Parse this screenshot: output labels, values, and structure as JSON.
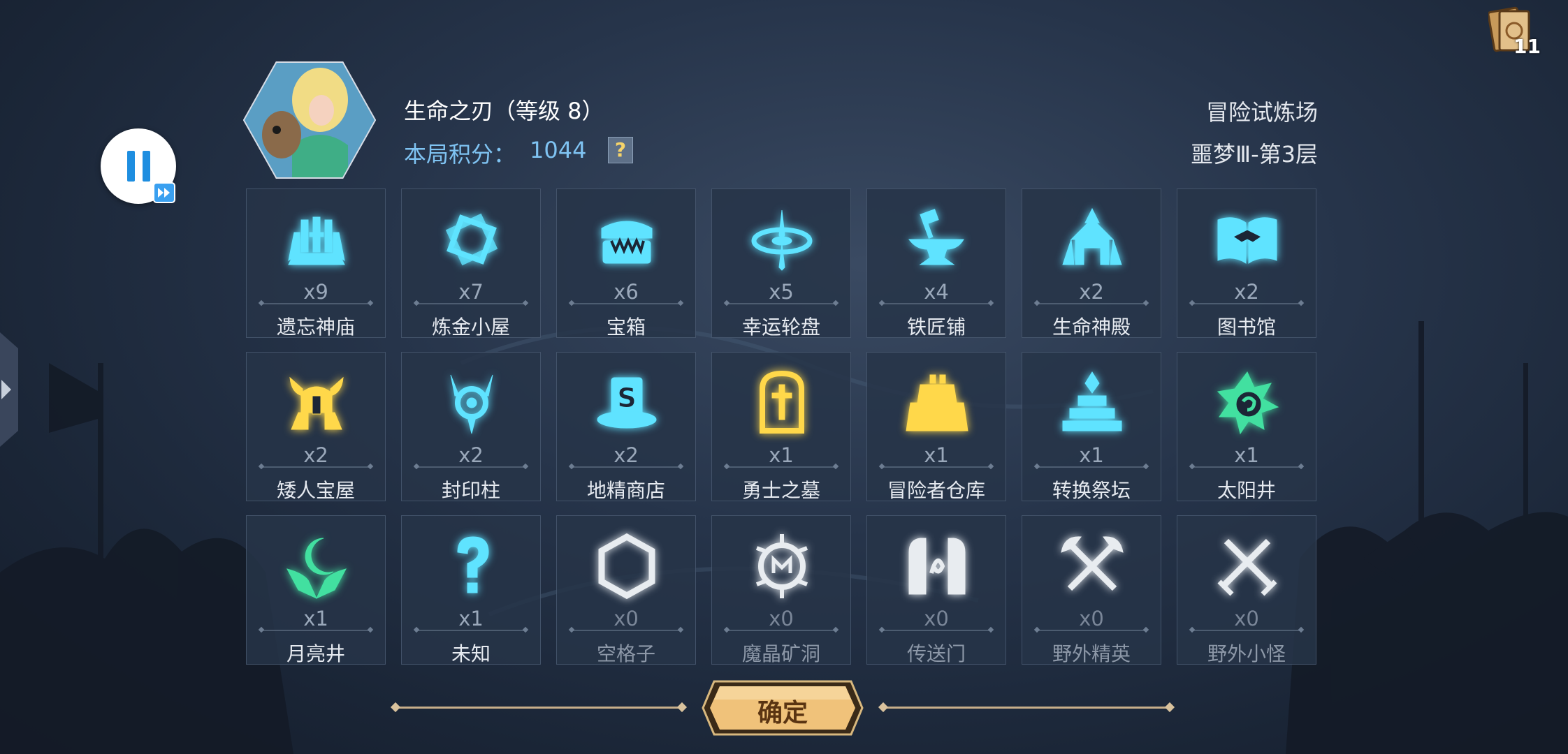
{
  "header": {
    "hero_name": "生命之刃（等级 8）",
    "score_label": "本局积分：",
    "score_value": "1044",
    "help_label": "?",
    "mode_name": "冒险试炼场",
    "floor_name": "噩梦Ⅲ-第3层"
  },
  "top_right": {
    "card_count": "11"
  },
  "tiles": [
    {
      "label": "遗忘神庙",
      "count": "x9",
      "icon": "temple-icon",
      "color": "#5fe3ff"
    },
    {
      "label": "炼金小屋",
      "count": "x7",
      "icon": "alchemy-icon",
      "color": "#5fe3ff"
    },
    {
      "label": "宝箱",
      "count": "x6",
      "icon": "chest-icon",
      "color": "#5fe3ff"
    },
    {
      "label": "幸运轮盘",
      "count": "x5",
      "icon": "wheel-icon",
      "color": "#5fe3ff"
    },
    {
      "label": "铁匠铺",
      "count": "x4",
      "icon": "anvil-icon",
      "color": "#5fe3ff"
    },
    {
      "label": "生命神殿",
      "count": "x2",
      "icon": "shrine-icon",
      "color": "#5fe3ff"
    },
    {
      "label": "图书馆",
      "count": "x2",
      "icon": "book-icon",
      "color": "#5fe3ff"
    },
    {
      "label": "矮人宝屋",
      "count": "x2",
      "icon": "dwarf-helmet-icon",
      "color": "#ffd84a"
    },
    {
      "label": "封印柱",
      "count": "x2",
      "icon": "seal-pillar-icon",
      "color": "#5fe3ff"
    },
    {
      "label": "地精商店",
      "count": "x2",
      "icon": "goblin-shop-icon",
      "color": "#5fe3ff"
    },
    {
      "label": "勇士之墓",
      "count": "x1",
      "icon": "tomb-icon",
      "color": "#ffd84a"
    },
    {
      "label": "冒险者仓库",
      "count": "x1",
      "icon": "warehouse-icon",
      "color": "#ffd84a"
    },
    {
      "label": "转换祭坛",
      "count": "x1",
      "icon": "altar-icon",
      "color": "#5fe3ff"
    },
    {
      "label": "太阳井",
      "count": "x1",
      "icon": "sun-well-icon",
      "color": "#42e0a0"
    },
    {
      "label": "月亮井",
      "count": "x1",
      "icon": "moon-well-icon",
      "color": "#42e0a0"
    },
    {
      "label": "未知",
      "count": "x1",
      "icon": "question-mark-icon",
      "color": "#5fe3ff"
    },
    {
      "label": "空格子",
      "count": "x0",
      "icon": "hexagon-icon",
      "color": "#e8ecf0"
    },
    {
      "label": "魔晶矿洞",
      "count": "x0",
      "icon": "crystal-mine-icon",
      "color": "#e8ecf0"
    },
    {
      "label": "传送门",
      "count": "x0",
      "icon": "portal-icon",
      "color": "#e8ecf0"
    },
    {
      "label": "野外精英",
      "count": "x0",
      "icon": "crossed-axes-icon",
      "color": "#e8ecf0"
    },
    {
      "label": "野外小怪",
      "count": "x0",
      "icon": "crossed-swords-icon",
      "color": "#e8ecf0"
    }
  ],
  "footer": {
    "confirm_label": "确定"
  }
}
